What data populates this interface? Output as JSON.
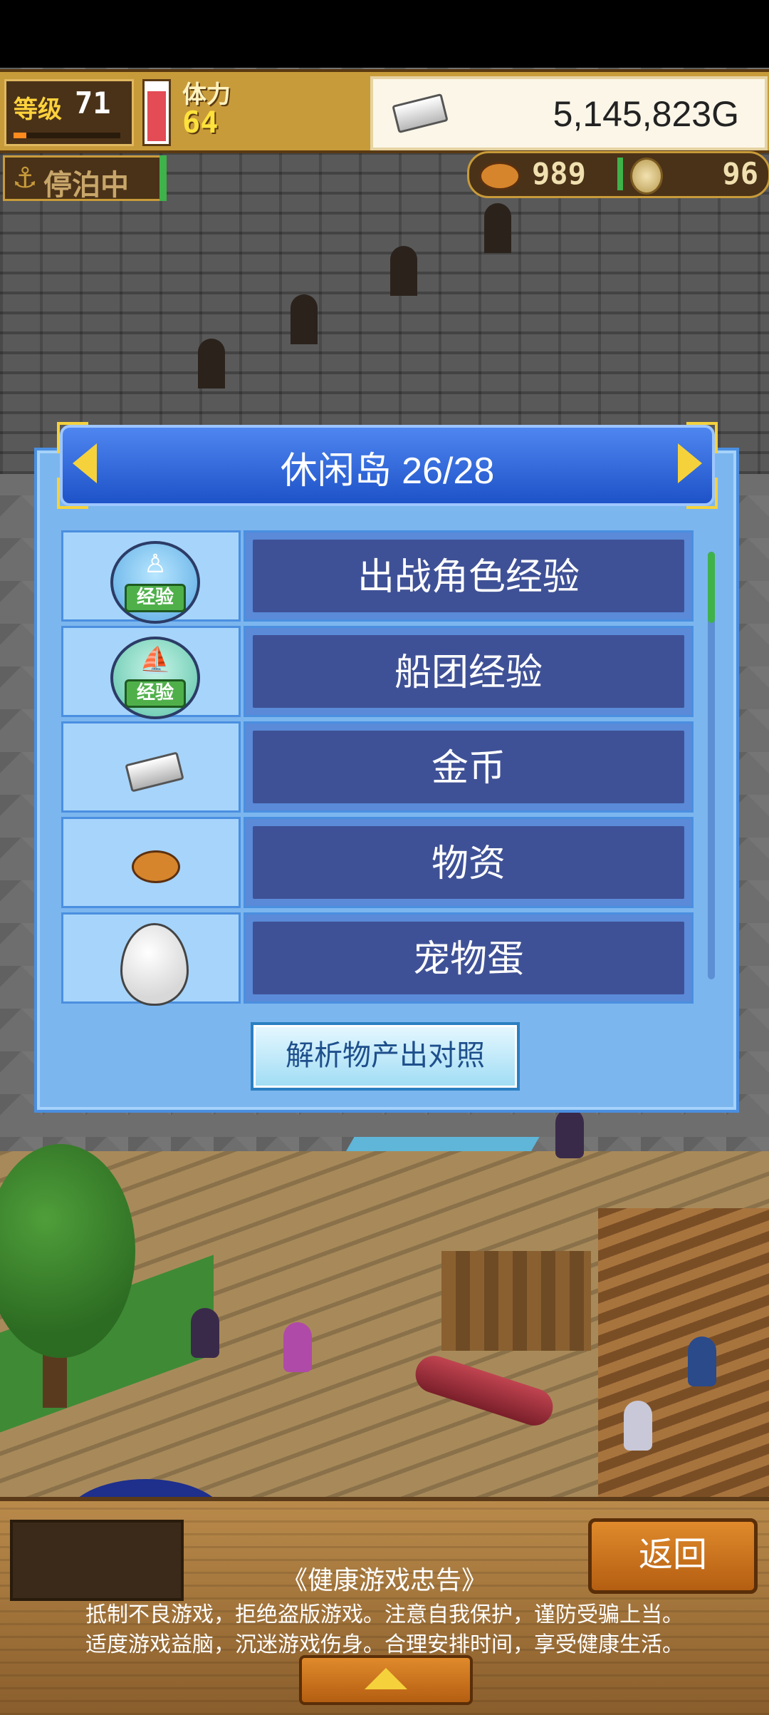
{
  "hud": {
    "level_label": "等级",
    "level": "71",
    "level_progress": 0.12,
    "hp_fraction": 0.95,
    "stamina_label": "体力",
    "stamina": "64",
    "gold": "5,145,823G",
    "status": "停泊中",
    "supplies": "989",
    "medals": "96"
  },
  "dialog": {
    "title": "休闲岛 26/28",
    "badge_text": "经验",
    "rows": [
      {
        "label": "出战角色经验",
        "icon": "person-exp-icon"
      },
      {
        "label": "船团经验",
        "icon": "ship-exp-icon"
      },
      {
        "label": "金币",
        "icon": "silver-bar-icon"
      },
      {
        "label": "物资",
        "icon": "meat-icon"
      },
      {
        "label": "宠物蛋",
        "icon": "egg-icon"
      }
    ],
    "analyze_button": "解析物产出对照",
    "scroll_position": 0.0
  },
  "footer": {
    "back_button": "返回",
    "advice_title": "《健康游戏忠告》",
    "advice_line1": "抵制不良游戏，拒绝盗版游戏。注意自我保护，谨防受骗上当。",
    "advice_line2": "适度游戏益脑，沉迷游戏伤身。合理安排时间，享受健康生活。"
  },
  "colors": {
    "dialog_bg": "#7cb6ee",
    "header_blue": "#1e52c8",
    "row_label_bg": "#3f5196",
    "accent_yellow": "#f5d23c",
    "hud_gold": "#c89b3a"
  }
}
